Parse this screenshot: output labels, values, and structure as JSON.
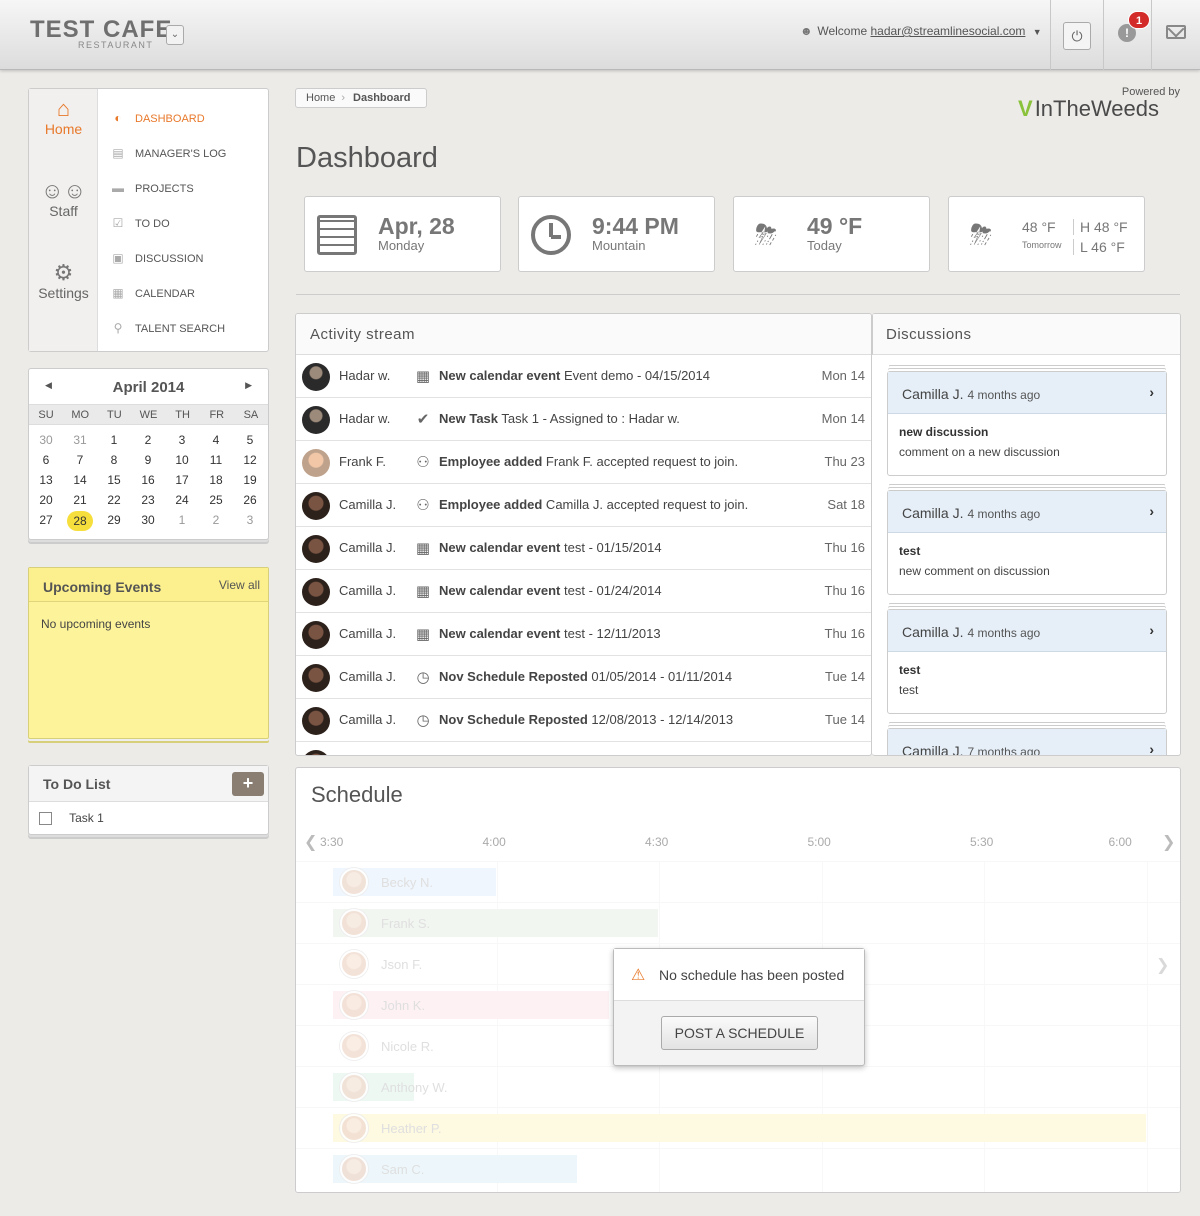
{
  "brand": {
    "name": "TEST CAFE",
    "subtitle": "RESTAURANT",
    "caret": "⌄"
  },
  "topbar": {
    "welcome_label": "Welcome",
    "user_email": "hadar@streamlinesocial.com",
    "alert_count": "1"
  },
  "nav": {
    "primary": [
      {
        "label": "Home",
        "icon": "home-icon",
        "active": true
      },
      {
        "label": "Staff",
        "icon": "users-icon",
        "active": false
      },
      {
        "label": "Settings",
        "icon": "gear-icon",
        "active": false
      }
    ],
    "submenu": [
      {
        "label": "DASHBOARD",
        "icon": "gauge-icon",
        "active": true
      },
      {
        "label": "MANAGER'S LOG",
        "icon": "document-icon",
        "active": false
      },
      {
        "label": "PROJECTS",
        "icon": "folder-icon",
        "active": false
      },
      {
        "label": "TO DO",
        "icon": "clipboard-icon",
        "active": false
      },
      {
        "label": "DISCUSSION",
        "icon": "chat-icon",
        "active": false
      },
      {
        "label": "CALENDAR",
        "icon": "calendar-icon",
        "active": false
      },
      {
        "label": "TALENT SEARCH",
        "icon": "user-search-icon",
        "active": false
      }
    ]
  },
  "minical": {
    "title": "April 2014",
    "dow": [
      "SU",
      "MO",
      "TU",
      "WE",
      "TH",
      "FR",
      "SA"
    ],
    "weeks": [
      [
        "30",
        "31",
        "1",
        "2",
        "3",
        "4",
        "5"
      ],
      [
        "6",
        "7",
        "8",
        "9",
        "10",
        "11",
        "12"
      ],
      [
        "13",
        "14",
        "15",
        "16",
        "17",
        "18",
        "19"
      ],
      [
        "20",
        "21",
        "22",
        "23",
        "24",
        "25",
        "26"
      ],
      [
        "27",
        "28",
        "29",
        "30",
        "1",
        "2",
        "3"
      ]
    ],
    "today": "28"
  },
  "events": {
    "title": "Upcoming Events",
    "view_all": "View all",
    "empty": "No upcoming events"
  },
  "todo": {
    "title": "To Do List",
    "add": "+",
    "items": [
      "Task 1"
    ]
  },
  "breadcrumb": {
    "home": "Home",
    "current": "Dashboard"
  },
  "powered": {
    "label": "Powered by",
    "logo": "InTheWeeds"
  },
  "page_title": "Dashboard",
  "cards": {
    "date": {
      "big": "Apr, 28",
      "small": "Monday"
    },
    "time": {
      "big": "9:44 PM",
      "small": "Mountain"
    },
    "weather": {
      "big": "49 °F",
      "small": "Today"
    },
    "forecast": {
      "temp": "48 °F",
      "label": "Tomorrow",
      "high": "H 48 °F",
      "low": "L 46 °F"
    }
  },
  "activity": {
    "title": "Activity stream",
    "rows": [
      {
        "who": "Hadar w.",
        "avatar": "a1",
        "icon": "calendar-icon",
        "bold": "New calendar event",
        "text": " Event demo - 04/15/2014",
        "date": "Mon 14"
      },
      {
        "who": "Hadar w.",
        "avatar": "a1",
        "icon": "checkmark-icon",
        "bold": "New Task",
        "text": " Task 1 - Assigned to : Hadar w.",
        "date": "Mon 14"
      },
      {
        "who": "Frank F.",
        "avatar": "a2",
        "icon": "add-user-icon",
        "bold": "Employee added",
        "text": " Frank F. accepted request to join.",
        "date": "Thu 23"
      },
      {
        "who": "Camilla J.",
        "avatar": "a3",
        "icon": "add-user-icon",
        "bold": "Employee added",
        "text": " Camilla J. accepted request to join.",
        "date": "Sat 18"
      },
      {
        "who": "Camilla J.",
        "avatar": "a3",
        "icon": "calendar-icon",
        "bold": "New calendar event",
        "text": " test - 01/15/2014",
        "date": "Thu 16"
      },
      {
        "who": "Camilla J.",
        "avatar": "a3",
        "icon": "calendar-icon",
        "bold": "New calendar event",
        "text": " test - 01/24/2014",
        "date": "Thu 16"
      },
      {
        "who": "Camilla J.",
        "avatar": "a3",
        "icon": "calendar-icon",
        "bold": "New calendar event",
        "text": " test - 12/11/2013",
        "date": "Thu 16"
      },
      {
        "who": "Camilla J.",
        "avatar": "a3",
        "icon": "schedule-icon",
        "bold": "Nov Schedule Reposted",
        "text": " 01/05/2014 - 01/11/2014",
        "date": "Tue 14"
      },
      {
        "who": "Camilla J.",
        "avatar": "a3",
        "icon": "schedule-icon",
        "bold": "Nov Schedule Reposted",
        "text": " 12/08/2013 - 12/14/2013",
        "date": "Tue 14"
      }
    ]
  },
  "discussions": {
    "title": "Discussions",
    "items": [
      {
        "who": "Camilla J.",
        "ago": "4 months ago",
        "title": "new discussion",
        "body": "comment on a new discussion"
      },
      {
        "who": "Camilla J.",
        "ago": "4 months ago",
        "title": "test",
        "body": "new comment on discussion"
      },
      {
        "who": "Camilla J.",
        "ago": "4 months ago",
        "title": "test",
        "body": "test"
      },
      {
        "who": "Camilla J.",
        "ago": "7 months ago",
        "title": "",
        "body": ""
      }
    ]
  },
  "schedule": {
    "title": "Schedule",
    "times": [
      "3:30",
      "4:00",
      "4:30",
      "5:00",
      "5:30",
      "6:00"
    ],
    "rows": [
      {
        "name": "Becky N.",
        "color": "#e3eefb",
        "start": 0.0,
        "end": 1.0
      },
      {
        "name": "Frank S.",
        "color": "#e6eee6",
        "start": 0.0,
        "end": 2.0
      },
      {
        "name": "Json F.",
        "color": "#ffffff",
        "start": 0.0,
        "end": 0.0
      },
      {
        "name": "John K.",
        "color": "#fbe6ea",
        "start": 0.0,
        "end": 1.7
      },
      {
        "name": "Nicole R.",
        "color": "#ffffff",
        "start": 0.0,
        "end": 0.0
      },
      {
        "name": "Anthony W.",
        "color": "#dff3ea",
        "start": 0.0,
        "end": 0.5
      },
      {
        "name": "Heather P.",
        "color": "#fdf4c9",
        "start": 0.0,
        "end": 5.0
      },
      {
        "name": "Sam C.",
        "color": "#dff0f8",
        "start": 0.0,
        "end": 1.5
      }
    ],
    "empty_message": "No schedule has been posted",
    "post_button": "POST A SCHEDULE"
  }
}
